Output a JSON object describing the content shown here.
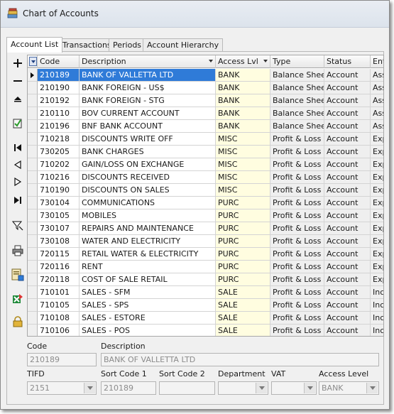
{
  "window": {
    "title": "Chart of Accounts"
  },
  "tabs": [
    {
      "label": "Account List",
      "active": true
    },
    {
      "label": "Transactions",
      "active": false
    },
    {
      "label": "Periods",
      "active": false
    },
    {
      "label": "Account Hierarchy",
      "active": false
    }
  ],
  "toolbar": [
    {
      "icon": "add-icon",
      "name": "add-button"
    },
    {
      "icon": "remove-icon",
      "name": "remove-button"
    },
    {
      "icon": "collapse-up-icon",
      "name": "move-up-button"
    },
    {
      "icon": "checklist-icon",
      "name": "validate-button"
    },
    {
      "icon": "first-record-icon",
      "name": "first-record-button"
    },
    {
      "icon": "previous-record-icon",
      "name": "previous-record-button"
    },
    {
      "icon": "next-record-icon",
      "name": "next-record-button"
    },
    {
      "icon": "last-record-icon",
      "name": "last-record-button"
    },
    {
      "icon": "filter-icon",
      "name": "filter-button"
    },
    {
      "icon": "print-icon",
      "name": "print-button"
    },
    {
      "icon": "report-icon",
      "name": "report-button"
    },
    {
      "icon": "excel-export-icon",
      "name": "export-button"
    },
    {
      "icon": "lock-icon",
      "name": "lock-button"
    }
  ],
  "grid": {
    "columns": [
      "Code",
      "Description",
      "Access Lvl",
      "Type",
      "Status",
      "Entr"
    ],
    "selected_index": 0,
    "rows": [
      {
        "code": "210189",
        "description": "BANK OF VALLETTA LTD",
        "access": "BANK",
        "type": "Balance Sheet",
        "status": "Account",
        "entry": "Asse"
      },
      {
        "code": "210190",
        "description": "BANK FOREIGN - US$",
        "access": "BANK",
        "type": "Balance Sheet",
        "status": "Account",
        "entry": "Asse"
      },
      {
        "code": "210192",
        "description": "BANK FOREIGN - STG",
        "access": "BANK",
        "type": "Balance Sheet",
        "status": "Account",
        "entry": "Asse"
      },
      {
        "code": "210110",
        "description": "BOV CURRENT ACCOUNT",
        "access": "BANK",
        "type": "Balance Sheet",
        "status": "Account",
        "entry": "Asse"
      },
      {
        "code": "210196",
        "description": "BNF BANK ACCOUNT",
        "access": "BANK",
        "type": "Balance Sheet",
        "status": "Account",
        "entry": "Asse"
      },
      {
        "code": "710218",
        "description": "DISCOUNTS WRITE OFF",
        "access": "MISC",
        "type": "Profit & Loss",
        "status": "Account",
        "entry": "Exp"
      },
      {
        "code": "730205",
        "description": "BANK CHARGES",
        "access": "MISC",
        "type": "Profit & Loss",
        "status": "Account",
        "entry": "Exp"
      },
      {
        "code": "710202",
        "description": "GAIN/LOSS ON EXCHANGE",
        "access": "MISC",
        "type": "Profit & Loss",
        "status": "Account",
        "entry": "Exp"
      },
      {
        "code": "710216",
        "description": "DISCOUNTS RECEIVED",
        "access": "MISC",
        "type": "Profit & Loss",
        "status": "Account",
        "entry": "Exp"
      },
      {
        "code": "710190",
        "description": "DISCOUNTS ON SALES",
        "access": "MISC",
        "type": "Profit & Loss",
        "status": "Account",
        "entry": "Exp"
      },
      {
        "code": "730104",
        "description": "COMMUNICATIONS",
        "access": "PURC",
        "type": "Profit & Loss",
        "status": "Account",
        "entry": "Exp"
      },
      {
        "code": "730105",
        "description": "MOBILES",
        "access": "PURC",
        "type": "Profit & Loss",
        "status": "Account",
        "entry": "Exp"
      },
      {
        "code": "730107",
        "description": "REPAIRS AND MAINTENANCE",
        "access": "PURC",
        "type": "Profit & Loss",
        "status": "Account",
        "entry": "Exp"
      },
      {
        "code": "730108",
        "description": "WATER AND ELECTRICITY",
        "access": "PURC",
        "type": "Profit & Loss",
        "status": "Account",
        "entry": "Exp"
      },
      {
        "code": "720115",
        "description": "RETAIL WATER & ELECTRICITY",
        "access": "PURC",
        "type": "Profit & Loss",
        "status": "Account",
        "entry": "Exp"
      },
      {
        "code": "720116",
        "description": "RENT",
        "access": "PURC",
        "type": "Profit & Loss",
        "status": "Account",
        "entry": "Exp"
      },
      {
        "code": "720118",
        "description": "COST OF SALE RETAIL",
        "access": "PURC",
        "type": "Profit & Loss",
        "status": "Account",
        "entry": "Exp"
      },
      {
        "code": "710101",
        "description": "SALES - SFM",
        "access": "SALE",
        "type": "Profit & Loss",
        "status": "Account",
        "entry": "Inco"
      },
      {
        "code": "710105",
        "description": "SALES - SPS",
        "access": "SALE",
        "type": "Profit & Loss",
        "status": "Account",
        "entry": "Inco"
      },
      {
        "code": "710108",
        "description": "SALES - ESTORE",
        "access": "SALE",
        "type": "Profit & Loss",
        "status": "Account",
        "entry": "Inco"
      },
      {
        "code": "710106",
        "description": "SALES - POS",
        "access": "SALE",
        "type": "Profit & Loss",
        "status": "Account",
        "entry": "Inco"
      }
    ]
  },
  "detail": {
    "code_label": "Code",
    "code_value": "210189",
    "description_label": "Description",
    "description_value": "BANK OF VALLETTA LTD",
    "tifd_label": "TIFD",
    "tifd_value": "2151",
    "sort_code1_label": "Sort Code 1",
    "sort_code1_value": "210189",
    "sort_code2_label": "Sort Code 2",
    "sort_code2_value": "",
    "department_label": "Department",
    "department_value": "",
    "vat_label": "VAT",
    "vat_value": "",
    "access_level_label": "Access Level",
    "access_level_value": "BANK"
  },
  "colors": {
    "selection": "#2f7bd8",
    "access_column": "#fffde0"
  }
}
